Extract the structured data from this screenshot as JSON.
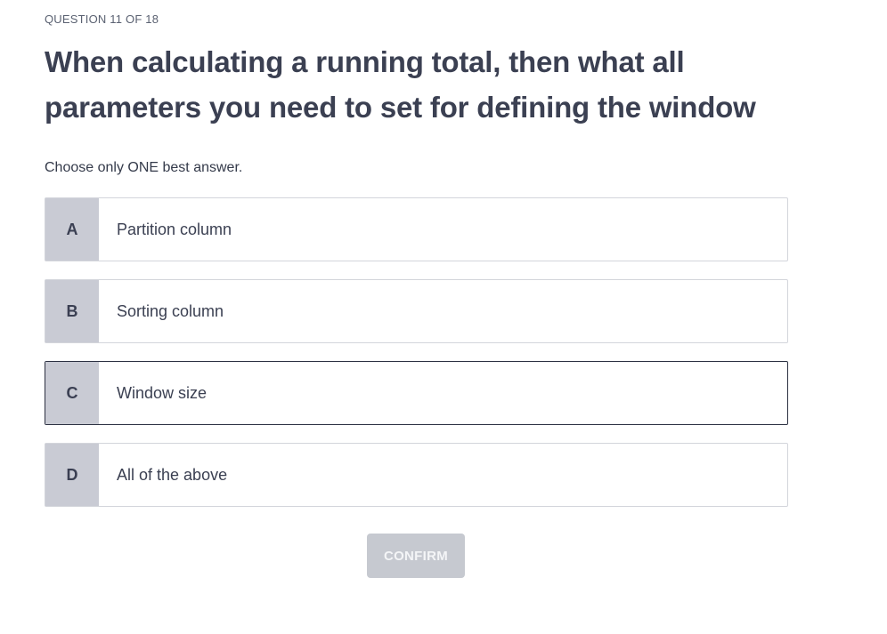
{
  "progress": "QUESTION 11 OF 18",
  "question": "When calculating a running total, then what all parameters you need to set for defining the window",
  "instruction": "Choose only ONE best answer.",
  "options": [
    {
      "letter": "A",
      "text": "Partition column"
    },
    {
      "letter": "B",
      "text": "Sorting column"
    },
    {
      "letter": "C",
      "text": "Window size"
    },
    {
      "letter": "D",
      "text": "All of the above"
    }
  ],
  "confirm_label": "CONFIRM",
  "colors": {
    "letter_bg": "#c9cbd4",
    "option_border": "#d3d5db",
    "hovered_border": "#2c3142",
    "confirm_disabled_bg": "#c6c9d0",
    "heading_text": "#3b4052"
  }
}
